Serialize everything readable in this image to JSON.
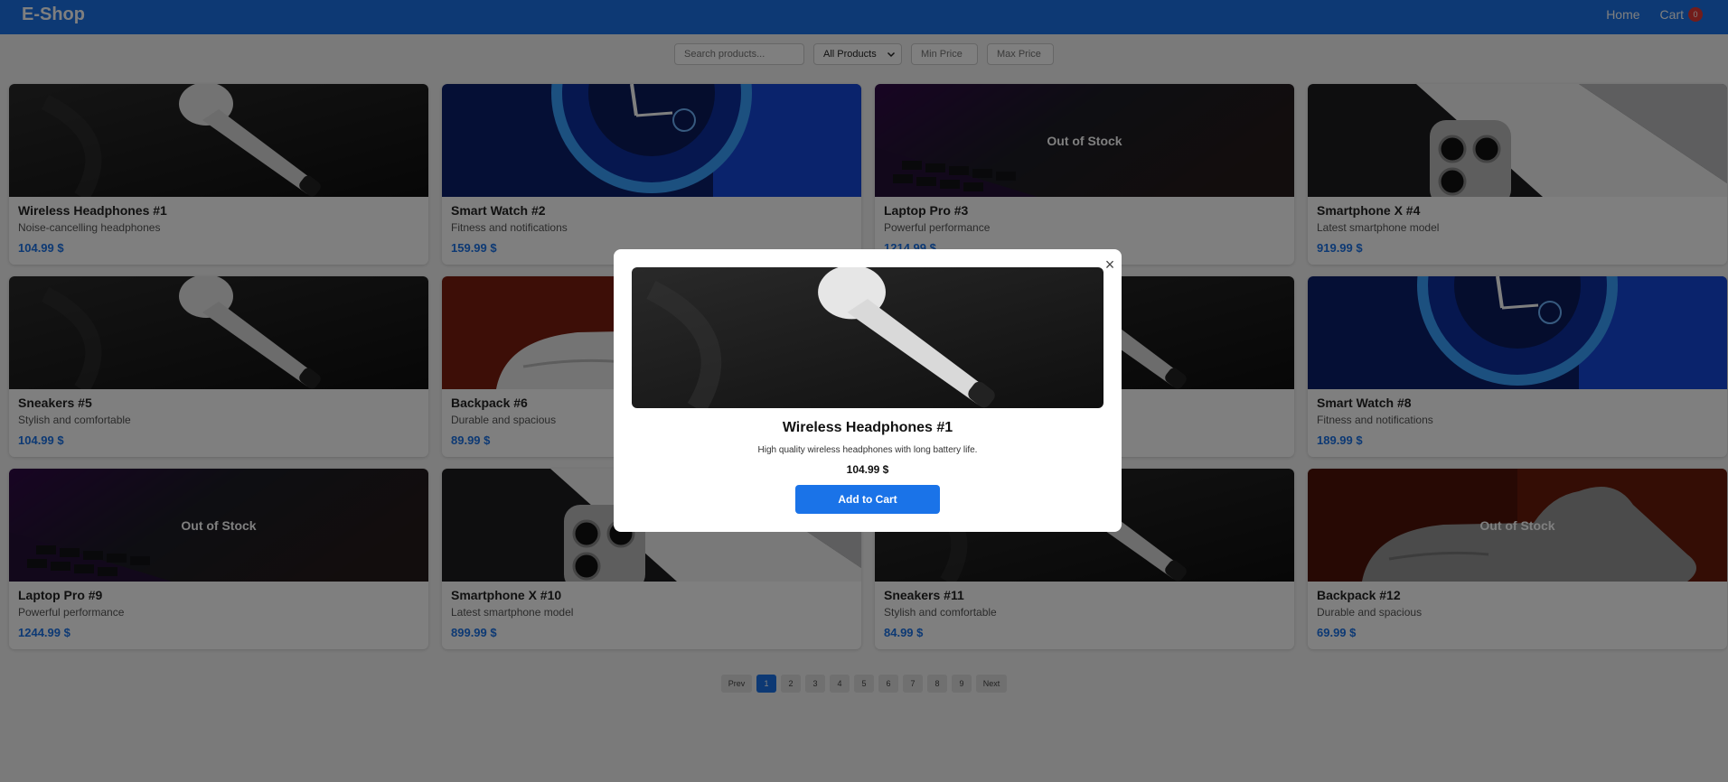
{
  "header": {
    "brand": "E-Shop",
    "home_label": "Home",
    "cart_label": "Cart",
    "cart_count": "0",
    "bg_color": "#1a73e8"
  },
  "filters": {
    "search_placeholder": "Search products...",
    "category_selected": "All Products",
    "min_price_placeholder": "Min Price",
    "max_price_placeholder": "Max Price"
  },
  "products": [
    {
      "name": "Wireless Headphones #1",
      "desc": "Noise-cancelling headphones",
      "price": "104.99 $",
      "image": "earbud",
      "out_of_stock": ""
    },
    {
      "name": "Smart Watch #2",
      "desc": "Fitness and notifications",
      "price": "159.99 $",
      "image": "watch",
      "out_of_stock": ""
    },
    {
      "name": "Laptop Pro #3",
      "desc": "Powerful performance",
      "price": "1214.99 $",
      "image": "laptop",
      "out_of_stock": "Out of Stock"
    },
    {
      "name": "Smartphone X #4",
      "desc": "Latest smartphone model",
      "price": "919.99 $",
      "image": "phone",
      "out_of_stock": ""
    },
    {
      "name": "Sneakers #5",
      "desc": "Stylish and comfortable",
      "price": "104.99 $",
      "image": "earbud",
      "out_of_stock": ""
    },
    {
      "name": "Backpack #6",
      "desc": "Durable and spacious",
      "price": "89.99 $",
      "image": "sneaker",
      "out_of_stock": ""
    },
    {
      "name": "",
      "desc": "",
      "price": "",
      "image": "earbud",
      "out_of_stock": ""
    },
    {
      "name": "Smart Watch #8",
      "desc": "Fitness and notifications",
      "price": "189.99 $",
      "image": "watch",
      "out_of_stock": ""
    },
    {
      "name": "Laptop Pro #9",
      "desc": "Powerful performance",
      "price": "1244.99 $",
      "image": "laptop",
      "out_of_stock": "Out of Stock"
    },
    {
      "name": "Smartphone X #10",
      "desc": "Latest smartphone model",
      "price": "899.99 $",
      "image": "phone",
      "out_of_stock": ""
    },
    {
      "name": "Sneakers #11",
      "desc": "Stylish and comfortable",
      "price": "84.99 $",
      "image": "earbud",
      "out_of_stock": ""
    },
    {
      "name": "Backpack #12",
      "desc": "Durable and spacious",
      "price": "69.99 $",
      "image": "sneaker",
      "out_of_stock": "Out of Stock"
    }
  ],
  "pagination": {
    "prev": "Prev",
    "next": "Next",
    "pages": [
      "1",
      "2",
      "3",
      "4",
      "5",
      "6",
      "7",
      "8",
      "9"
    ],
    "current": "1"
  },
  "modal": {
    "close_symbol": "×",
    "title": "Wireless Headphones #1",
    "description": "High quality wireless headphones with long battery life.",
    "price": "104.99 $",
    "button_label": "Add to Cart",
    "image": "earbud"
  }
}
